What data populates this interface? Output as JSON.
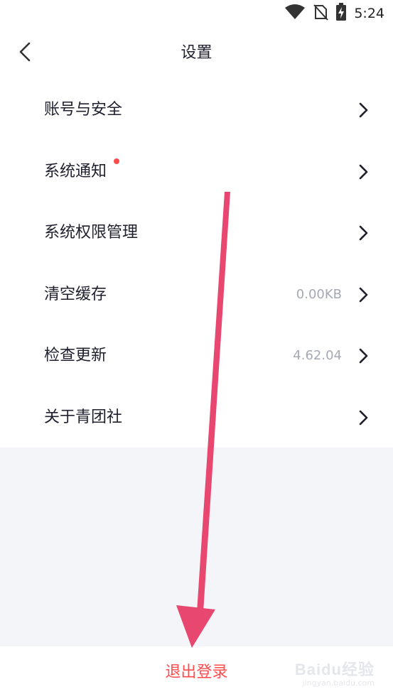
{
  "status": {
    "time": "5:24"
  },
  "header": {
    "title": "设置"
  },
  "settings": {
    "items": [
      {
        "label": "账号与安全",
        "value": "",
        "has_dot": false
      },
      {
        "label": "系统通知",
        "value": "",
        "has_dot": true
      },
      {
        "label": "系统权限管理",
        "value": "",
        "has_dot": false
      },
      {
        "label": "清空缓存",
        "value": "0.00KB",
        "has_dot": false
      },
      {
        "label": "检查更新",
        "value": "4.62.04",
        "has_dot": false
      },
      {
        "label": "关于青团社",
        "value": "",
        "has_dot": false
      }
    ]
  },
  "footer": {
    "logout_label": "退出登录"
  },
  "watermark": {
    "logo": "Baidu经验",
    "url": "jingyan.baidu.com"
  },
  "colors": {
    "accent_red": "#ff4b4b",
    "annotation_pink": "#e8476f",
    "gray_bg": "#f4f5f9"
  },
  "icons": [
    "wifi-icon",
    "no-sim-icon",
    "battery-charging-icon",
    "back-arrow-icon",
    "chevron-right-icon",
    "notification-dot-icon"
  ]
}
